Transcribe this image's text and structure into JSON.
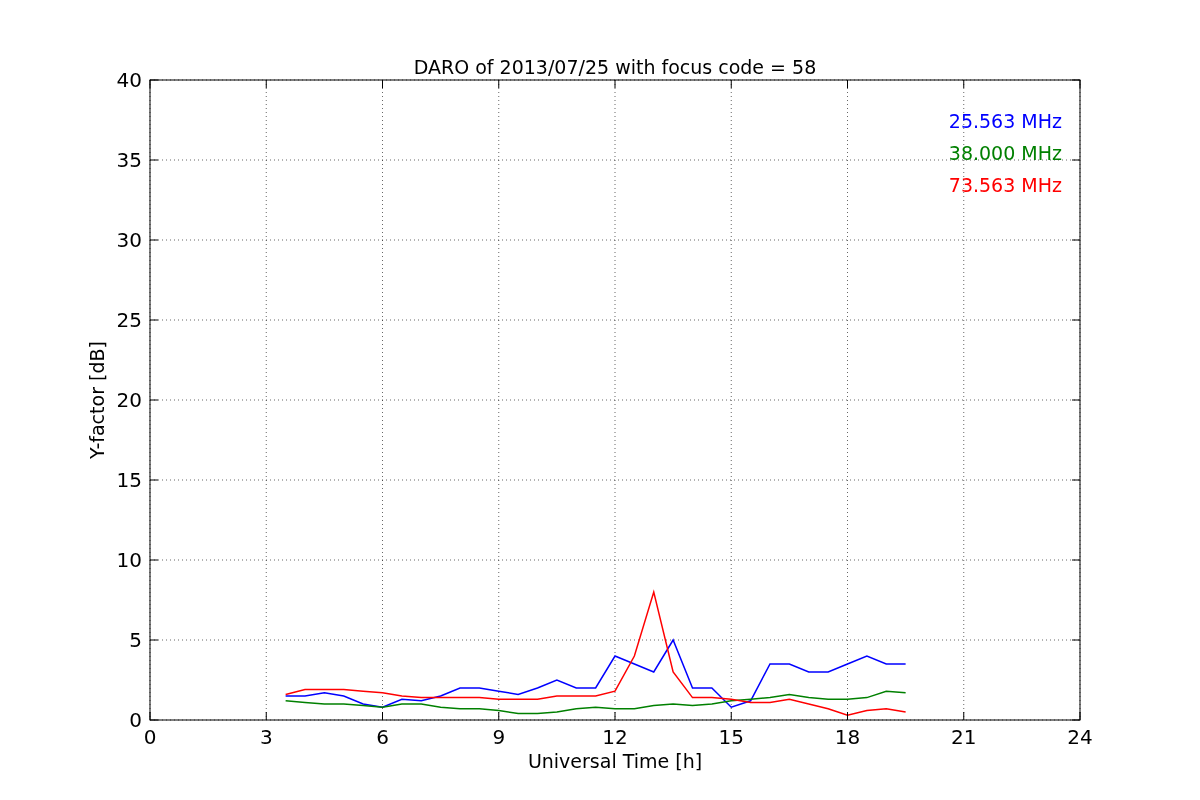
{
  "figure": {
    "chart_data": {
      "type": "line",
      "title": "DARO of 2013/07/25 with focus code = 58",
      "xlabel": "Universal Time [h]",
      "ylabel": "Y-factor [dB]",
      "x": [
        3.5,
        4,
        4.5,
        5,
        5.5,
        6,
        6.5,
        7,
        7.5,
        8,
        8.5,
        9,
        9.5,
        10,
        10.5,
        11,
        11.5,
        12,
        12.5,
        13,
        13.5,
        14,
        14.5,
        15,
        15.5,
        16,
        16.5,
        17,
        17.5,
        18,
        18.5,
        19,
        19.5
      ],
      "series": [
        {
          "name": "25.563 MHz",
          "color": "#0000ff",
          "values": [
            1.5,
            1.5,
            1.7,
            1.5,
            1.0,
            0.8,
            1.3,
            1.2,
            1.5,
            2,
            2,
            1.8,
            1.6,
            2,
            2.5,
            2,
            2,
            4,
            3.5,
            3,
            5,
            2,
            2,
            0.8,
            1.2,
            3.5,
            3.5,
            3,
            3,
            3.5,
            4,
            3.5,
            3.5
          ]
        },
        {
          "name": "38.000 MHz",
          "color": "#008000",
          "values": [
            1.2,
            1.1,
            1.0,
            1.0,
            0.9,
            0.8,
            1.0,
            1.0,
            0.8,
            0.7,
            0.7,
            0.6,
            0.4,
            0.4,
            0.5,
            0.7,
            0.8,
            0.7,
            0.7,
            0.9,
            1.0,
            0.9,
            1.0,
            1.2,
            1.3,
            1.4,
            1.6,
            1.4,
            1.3,
            1.3,
            1.4,
            1.8,
            1.7
          ]
        },
        {
          "name": "73.563 MHz",
          "color": "#ff0000",
          "values": [
            1.6,
            1.9,
            1.9,
            1.9,
            1.8,
            1.7,
            1.5,
            1.4,
            1.4,
            1.4,
            1.4,
            1.3,
            1.3,
            1.3,
            1.5,
            1.5,
            1.5,
            1.8,
            4,
            8,
            3,
            1.4,
            1.4,
            1.3,
            1.1,
            1.1,
            1.3,
            1.0,
            0.7,
            0.3,
            0.6,
            0.7,
            0.5
          ]
        }
      ],
      "xlim": [
        0,
        24
      ],
      "ylim": [
        0,
        40
      ],
      "xticks": [
        0,
        3,
        6,
        9,
        12,
        15,
        18,
        21,
        24
      ],
      "yticks": [
        0,
        5,
        10,
        15,
        20,
        25,
        30,
        35,
        40
      ],
      "grid": true
    }
  }
}
